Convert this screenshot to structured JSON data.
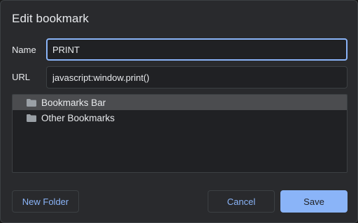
{
  "dialog": {
    "title": "Edit bookmark"
  },
  "form": {
    "name_label": "Name",
    "name_value": "PRINT",
    "url_label": "URL",
    "url_value": "javascript:window.print()"
  },
  "folders": [
    {
      "label": "Bookmarks Bar",
      "icon": "folder-icon",
      "selected": true
    },
    {
      "label": "Other Bookmarks",
      "icon": "folder-icon",
      "selected": false
    }
  ],
  "buttons": {
    "new_folder": "New Folder",
    "cancel": "Cancel",
    "save": "Save"
  },
  "colors": {
    "accent": "#8ab4f8",
    "background": "#292a2d",
    "selected_row": "#4b4c4f"
  }
}
